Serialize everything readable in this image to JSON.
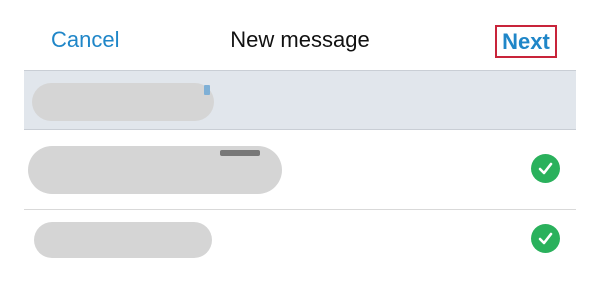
{
  "nav": {
    "cancel_label": "Cancel",
    "title": "New message",
    "next_label": "Next"
  },
  "recipients": [
    {
      "name": "",
      "selected_row": true,
      "checked": false
    },
    {
      "name": "",
      "selected_row": false,
      "checked": true
    },
    {
      "name": "",
      "selected_row": false,
      "checked": true
    }
  ],
  "colors": {
    "link": "#1f86c8",
    "highlight_border": "#c8243a",
    "check_green": "#2ab15c",
    "selected_row_bg": "#e1e6ec"
  },
  "icons": {
    "check": "checkmark-circle-icon"
  }
}
